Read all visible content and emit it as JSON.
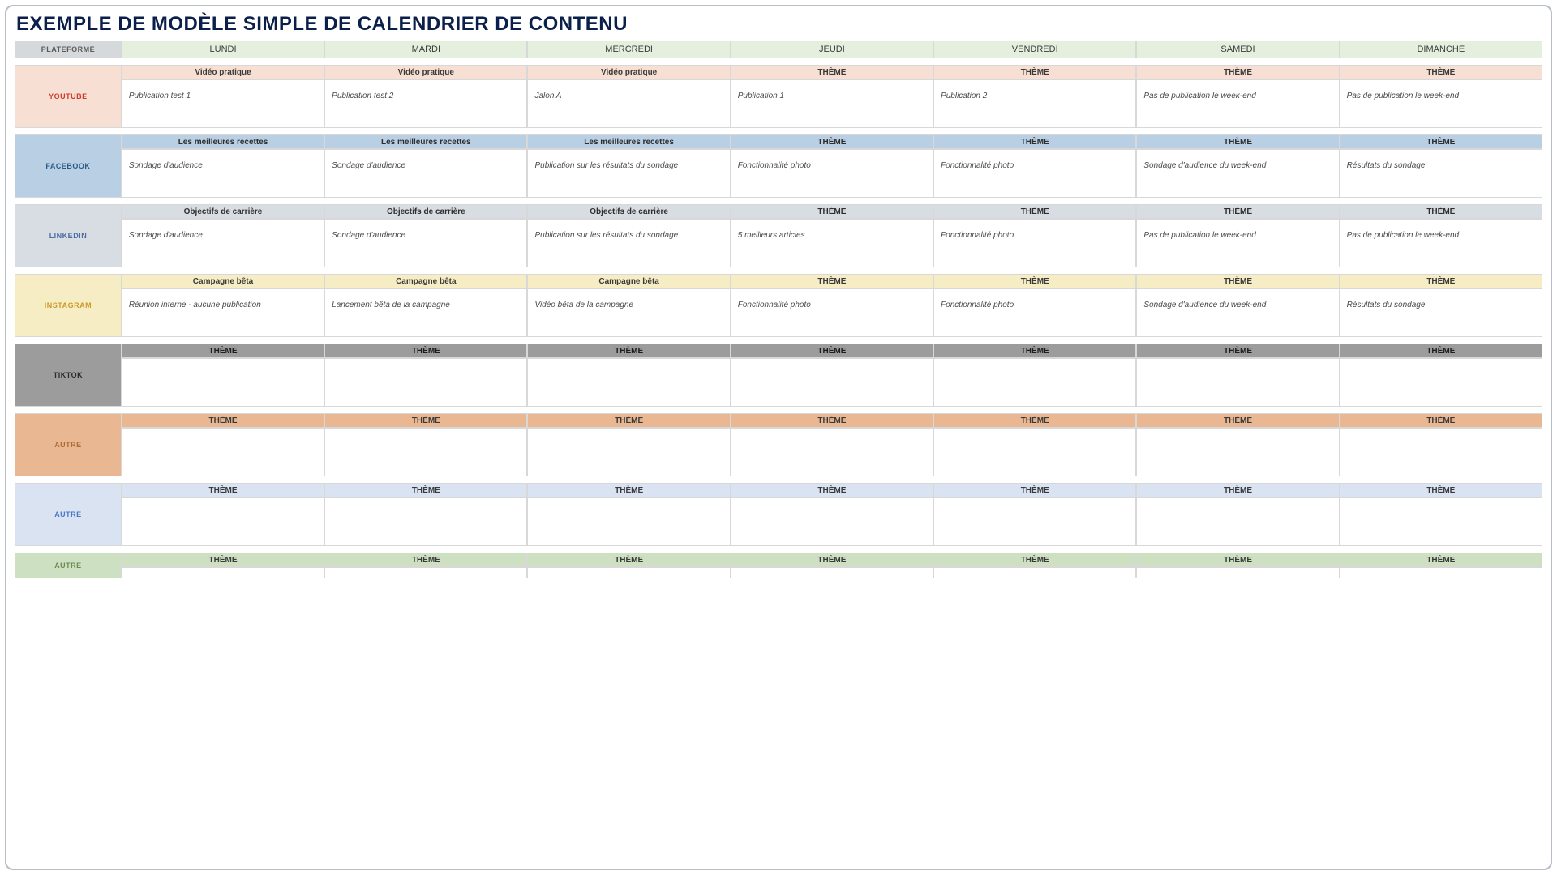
{
  "title": "EXEMPLE DE MODÈLE SIMPLE DE CALENDRIER DE CONTENU",
  "header": {
    "platform_label": "PLATEFORME",
    "days": [
      "LUNDI",
      "MARDI",
      "MERCREDI",
      "JEUDI",
      "VENDREDI",
      "SAMEDI",
      "DIMANCHE"
    ]
  },
  "default_theme": "THÈME",
  "platforms": [
    {
      "key": "youtube",
      "name": "YOUTUBE",
      "themes": [
        "Vidéo pratique",
        "Vidéo pratique",
        "Vidéo pratique",
        "THÈME",
        "THÈME",
        "THÈME",
        "THÈME"
      ],
      "content": [
        "Publication test 1",
        "Publication test 2",
        "Jalon A",
        "Publication 1",
        "Publication 2",
        "Pas de publication le week-end",
        "Pas de publication le week-end"
      ]
    },
    {
      "key": "facebook",
      "name": "FACEBOOK",
      "themes": [
        "Les meilleures recettes",
        "Les meilleures recettes",
        "Les meilleures recettes",
        "THÈME",
        "THÈME",
        "THÈME",
        "THÈME"
      ],
      "content": [
        "Sondage d'audience",
        "Sondage d'audience",
        "Publication sur les résultats du sondage",
        "Fonctionnalité photo",
        "Fonctionnalité photo",
        "Sondage d'audience du week-end",
        "Résultats du sondage"
      ]
    },
    {
      "key": "linkedin",
      "name": "LINKEDIN",
      "themes": [
        "Objectifs de carrière",
        "Objectifs de carrière",
        "Objectifs de carrière",
        "THÈME",
        "THÈME",
        "THÈME",
        "THÈME"
      ],
      "content": [
        "Sondage d'audience",
        "Sondage d'audience",
        "Publication sur les résultats du sondage",
        "5 meilleurs articles",
        "Fonctionnalité photo",
        "Pas de publication le week-end",
        "Pas de publication le week-end"
      ]
    },
    {
      "key": "instagram",
      "name": "INSTAGRAM",
      "themes": [
        "Campagne bêta",
        "Campagne bêta",
        "Campagne bêta",
        "THÈME",
        "THÈME",
        "THÈME",
        "THÈME"
      ],
      "content": [
        "Réunion interne - aucune publication",
        "Lancement bêta de la campagne",
        "Vidéo bêta de la campagne",
        "Fonctionnalité photo",
        "Fonctionnalité photo",
        "Sondage d'audience du week-end",
        "Résultats du sondage"
      ]
    },
    {
      "key": "tiktok",
      "name": "TIKTOK",
      "themes": [
        "THÈME",
        "THÈME",
        "THÈME",
        "THÈME",
        "THÈME",
        "THÈME",
        "THÈME"
      ],
      "content": [
        "",
        "",
        "",
        "",
        "",
        "",
        ""
      ]
    },
    {
      "key": "autre1",
      "name": "AUTRE",
      "themes": [
        "THÈME",
        "THÈME",
        "THÈME",
        "THÈME",
        "THÈME",
        "THÈME",
        "THÈME"
      ],
      "content": [
        "",
        "",
        "",
        "",
        "",
        "",
        ""
      ]
    },
    {
      "key": "autre2",
      "name": "AUTRE",
      "themes": [
        "THÈME",
        "THÈME",
        "THÈME",
        "THÈME",
        "THÈME",
        "THÈME",
        "THÈME"
      ],
      "content": [
        "",
        "",
        "",
        "",
        "",
        "",
        ""
      ]
    },
    {
      "key": "autre3",
      "name": "AUTRE",
      "themes": [
        "THÈME",
        "THÈME",
        "THÈME",
        "THÈME",
        "THÈME",
        "THÈME",
        "THÈME"
      ],
      "content": [
        "",
        "",
        "",
        "",
        "",
        "",
        ""
      ]
    }
  ]
}
